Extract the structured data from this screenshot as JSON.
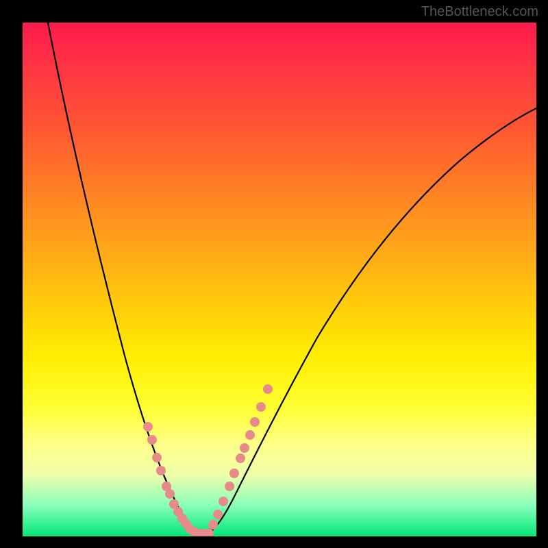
{
  "watermark": "TheBottleneck.com",
  "chart_data": {
    "type": "line",
    "title": "",
    "xlabel": "",
    "ylabel": "",
    "xlim": [
      0,
      100
    ],
    "ylim": [
      0,
      100
    ],
    "background": "rainbow-gradient-red-to-green",
    "series": [
      {
        "name": "left-curve",
        "type": "line",
        "color": "#000000",
        "x": [
          5,
          8,
          12,
          16,
          20,
          24,
          27,
          29,
          30.5,
          32,
          34
        ],
        "y": [
          100,
          80,
          60,
          42,
          28,
          17,
          10,
          6,
          3.5,
          1.5,
          0.2
        ]
      },
      {
        "name": "right-curve",
        "type": "line",
        "color": "#000000",
        "x": [
          34,
          36,
          38,
          41,
          45,
          50,
          56,
          63,
          71,
          80,
          90,
          100
        ],
        "y": [
          0.2,
          1.5,
          4,
          9,
          17,
          27,
          38,
          49,
          59,
          68,
          76,
          82
        ]
      },
      {
        "name": "left-dots",
        "type": "scatter",
        "color": "#e68a8a",
        "x": [
          24.2,
          25.0,
          26.0,
          26.8,
          27.8,
          28.4,
          29.2,
          30.0,
          30.8,
          31.5,
          32.3,
          33.0,
          34.0,
          35.0,
          36.0
        ],
        "y": [
          21.0,
          18.5,
          15.0,
          12.5,
          9.5,
          8.0,
          6.0,
          4.5,
          3.2,
          2.2,
          1.2,
          0.6,
          0.2,
          0.2,
          0.3
        ]
      },
      {
        "name": "right-dots",
        "type": "scatter",
        "color": "#e68a8a",
        "x": [
          36.8,
          37.8,
          38.8,
          40.0,
          41.0,
          42.2,
          43.0,
          44.0,
          45.0,
          46.2,
          47.5
        ],
        "y": [
          2.0,
          4.0,
          6.5,
          9.5,
          12.0,
          15.0,
          17.0,
          19.5,
          22.0,
          25.0,
          28.5
        ]
      }
    ]
  }
}
